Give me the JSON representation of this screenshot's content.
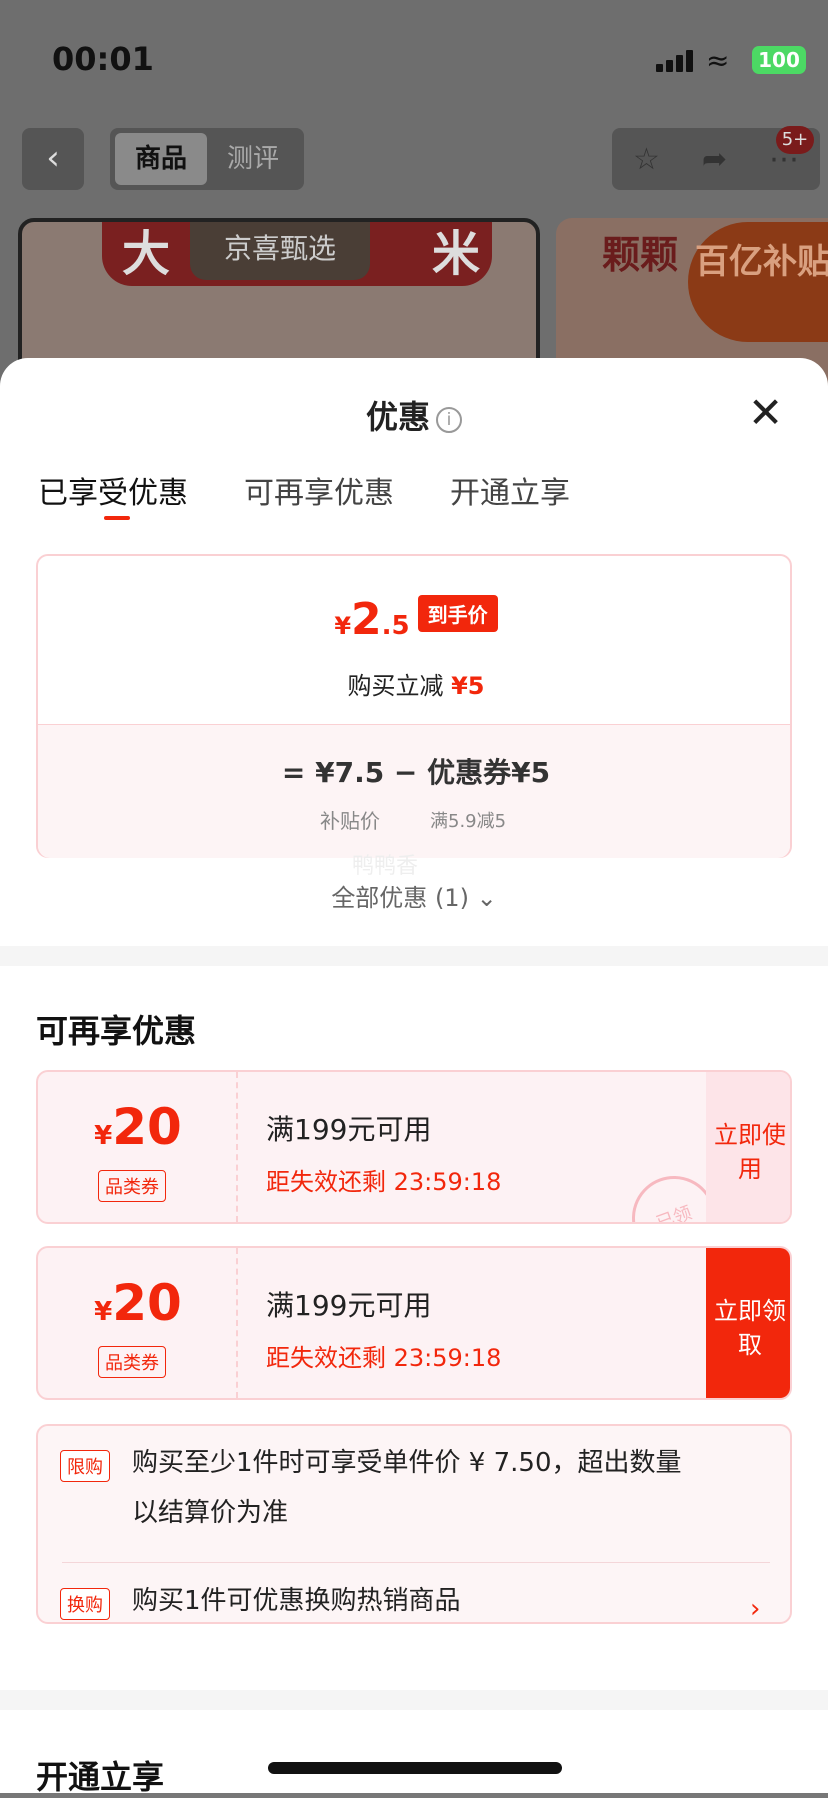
{
  "status_bar": {
    "time": "00:01",
    "battery": "100"
  },
  "nav": {
    "tabs": [
      "商品",
      "测评"
    ],
    "badge": "5+"
  },
  "background": {
    "banner_left": "大",
    "banner_left_tail": "米",
    "banner_tag": "京喜甄选",
    "banner_right": "颗颗",
    "subsidy": "百亿补贴"
  },
  "sheet": {
    "title": "优惠",
    "tabs": [
      "已享受优惠",
      "可再享优惠",
      "开通立享"
    ],
    "current": {
      "currency": "¥",
      "price_int": "2",
      "price_dec": ".5",
      "price_label": "到手价",
      "reduce_text": "购买立减",
      "reduce_value": "¥5",
      "formula": "=  ¥7.5  −  优惠券¥5",
      "sub1": "补贴价",
      "sub2": "满5.9减5",
      "watermark": "鸭鸭香"
    },
    "all_offers": "全部优惠 (1)",
    "section2_title": "可再享优惠",
    "coupons": [
      {
        "currency": "¥",
        "amount": "20",
        "type": "品类券",
        "condition": "满199元可用",
        "expiry": "距失效还剩 23:59:18",
        "button": "立即使用",
        "stamp": "已领"
      },
      {
        "currency": "¥",
        "amount": "20",
        "type": "品类券",
        "condition": "满199元可用",
        "expiry": "距失效还剩 23:59:18",
        "button": "立即领取"
      }
    ],
    "rules": [
      {
        "tag": "限购",
        "text": "购买至少1件时可享受单件价 ¥ 7.50，超出数量以结算价为准"
      },
      {
        "tag": "换购",
        "text": "购买1件可优惠换购热销商品"
      }
    ],
    "section3_title": "开通立享"
  },
  "colors": {
    "accent": "#f2270c",
    "card_border": "#fad0d3",
    "card_bg": "#fdf2f4"
  }
}
